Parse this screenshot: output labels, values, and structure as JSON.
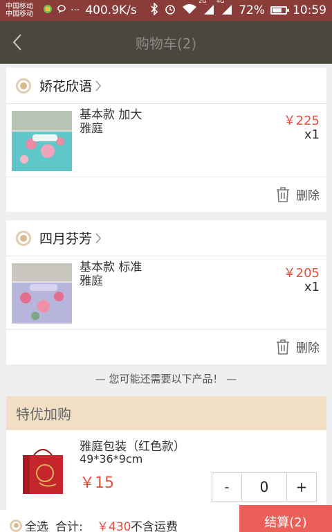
{
  "status_bar": {
    "carrier_1": "中国移动",
    "carrier_2": "中国移动",
    "icons_left": [
      "sim-icon",
      "message-icon"
    ],
    "more": "···",
    "net_speed": "400.9K/s",
    "net_2g": "2G",
    "net_4g": "4G",
    "battery": "72%",
    "battery_level": 0.72,
    "time": "10:59"
  },
  "navbar": {
    "title": "购物车(2)",
    "back_icon": "chevron-left-icon"
  },
  "shops": [
    {
      "name": "娇花欣语",
      "item": {
        "title": "基本款 加大",
        "brand": "雅庭",
        "price": "￥225",
        "qty": "x1"
      },
      "delete_label": "删除"
    },
    {
      "name": "四月芬芳",
      "item": {
        "title": "基本款 标准",
        "brand": "雅庭",
        "price": "￥205",
        "qty": "x1"
      },
      "delete_label": "删除"
    }
  ],
  "suggest": "— 您可能还需要以下产品！ —",
  "promo": {
    "header": "特优加购",
    "item": {
      "title": "雅庭包装（红色款）",
      "size": "49*36*9cm",
      "price": "￥15"
    },
    "stepper": {
      "minus": "-",
      "value": "0",
      "plus": "+"
    }
  },
  "bottom": {
    "select_all": "全选",
    "total_label": "合计:",
    "total_amount": "￥430",
    "shipping_note": "不含运费",
    "checkout": "结算(2)"
  },
  "colors": {
    "accent": "#e84e3c",
    "nav_bg": "#4a4740",
    "status_bg": "#8a3c38",
    "promo_header": "#f0dfc4",
    "checkout_bg": "#ec5e58",
    "radio": "#d9b98e"
  }
}
